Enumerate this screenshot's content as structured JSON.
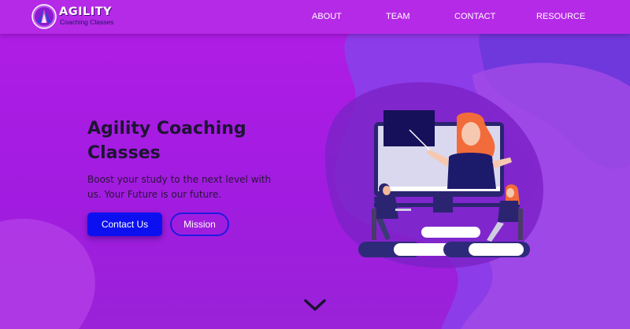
{
  "brand": {
    "name": "AGILITY",
    "tagline": "Coaching Classes"
  },
  "nav": {
    "items": [
      {
        "label": "ABOUT"
      },
      {
        "label": "TEAM"
      },
      {
        "label": "CONTACT"
      },
      {
        "label": "RESOURCE"
      }
    ]
  },
  "hero": {
    "title": "Agility Coaching Classes",
    "subtitle": "Boost your study to the next level with us. Your Future is our future.",
    "primary_button": "Contact Us",
    "secondary_button": "Mission"
  },
  "icons": {
    "logo": "triangle-logo-icon",
    "scroll": "chevron-down-icon"
  },
  "colors": {
    "background": "#a81ee3",
    "navbar": "#b52ae6",
    "primary_button": "#0c10f0",
    "outline_button": "#1e1adf",
    "title_text": "#1e1432"
  }
}
